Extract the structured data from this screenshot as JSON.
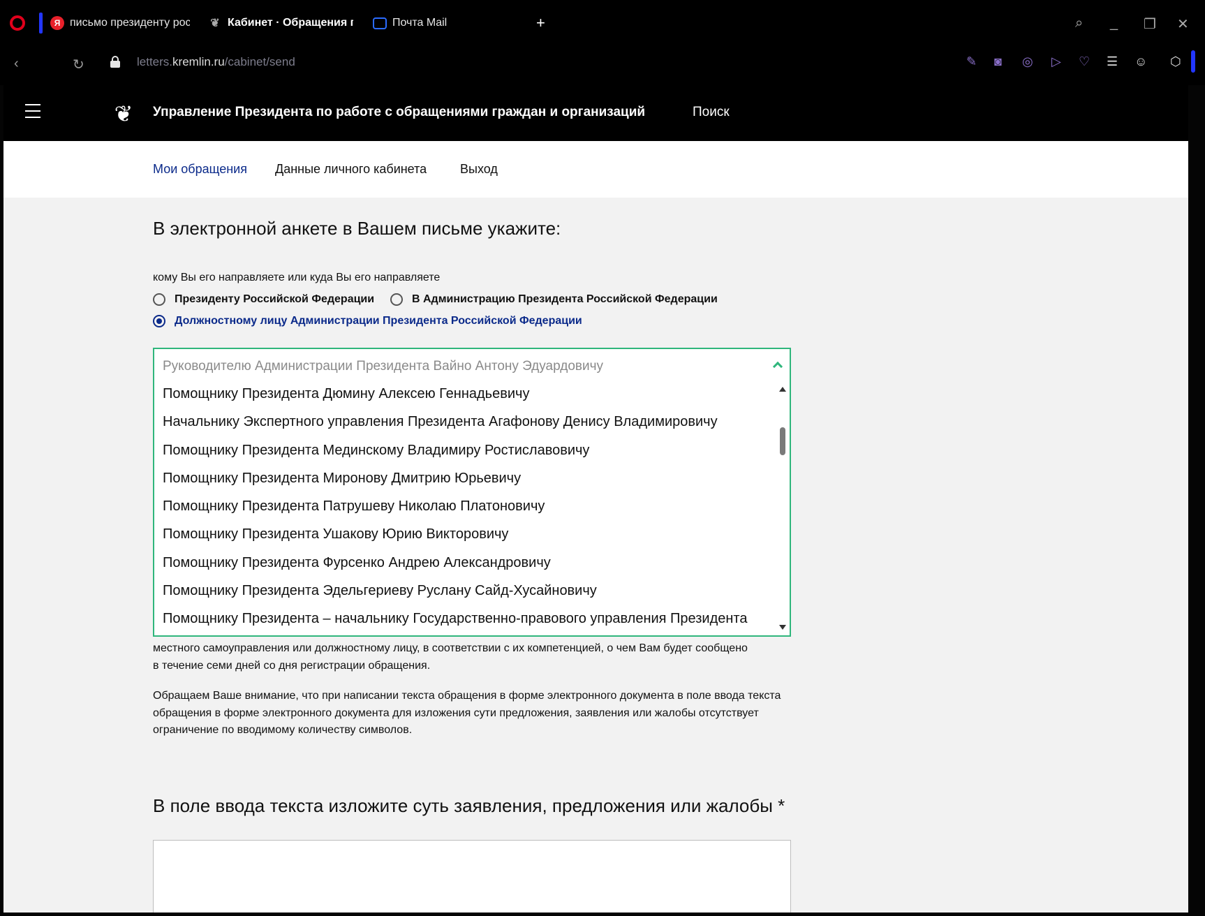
{
  "browser": {
    "tabs": [
      {
        "label": "письмо президенту рос",
        "icon": "yandex-icon",
        "active": false
      },
      {
        "label": "Кабинет · Обращения гр",
        "icon": "emblem-icon",
        "active": true
      },
      {
        "label": "Почта Mail",
        "icon": "mail-icon",
        "active": false
      }
    ],
    "new_tab": "+",
    "address": {
      "scheme_prefix": "letters.",
      "host": "kremlin.ru",
      "path": "/cabinet/send"
    }
  },
  "site": {
    "title": "Управление Президента по работе с обращениями граждан и организаций",
    "search_label": "Поиск"
  },
  "cabinet_nav": {
    "items": [
      "Мои обращения",
      "Данные личного кабинета",
      "Выход"
    ],
    "active": "Мои обращения"
  },
  "form": {
    "heading": "В электронной анкете в Вашем письме укажите:",
    "recipient_note": "кому Вы его направляете или куда Вы его направляете",
    "radios": [
      {
        "label": "Президенту Российской Федерации",
        "checked": false
      },
      {
        "label": "В Администрацию Президента Российской Федерации",
        "checked": false
      },
      {
        "label": "Должностному лицу Администрации Президента Российской Федерации",
        "checked": true
      }
    ],
    "select": {
      "value": "Руководителю Администрации Президента Вайно Антону Эдуардовичу",
      "options": [
        "Помощнику Президента Дюмину Алексею Геннадьевичу",
        "Начальнику Экспертного управления Президента Агафонову Денису Владимировичу",
        "Помощнику Президента Мединскому Владимиру Ростиславовичу",
        "Помощнику Президента Миронову Дмитрию Юрьевичу",
        "Помощнику Президента Патрушеву Николаю Платоновичу",
        "Помощнику Президента Ушакову Юрию Викторовичу",
        "Помощнику Президента Фурсенко Андрею Александровичу",
        "Помощнику Президента Эдельгериеву Руслану Сайд-Хусайновичу",
        "Помощнику Президента – начальнику Государственно-правового управления Президента"
      ]
    },
    "para_after_select_line1": "местного самоуправления или должностному лицу, в соответствии с их компетенцией, о чем Вам будет сообщено",
    "para_after_select_line2": "в течение семи дней со дня регистрации обращения.",
    "attention_para": "Обращаем Ваше внимание, что при написании текста обращения в форме электронного документа в поле ввода текста обращения в форме электронного документа для изложения сути предложения, заявления или жалобы отсутствует ограничение по вводимому количеству символов.",
    "text_heading": "В поле ввода текста изложите суть заявления, предложения или жалобы *",
    "textarea_value": ""
  },
  "colors": {
    "accent_blue": "#0b2a8a",
    "focus_green": "#2fb67c",
    "header_black": "#000000"
  }
}
